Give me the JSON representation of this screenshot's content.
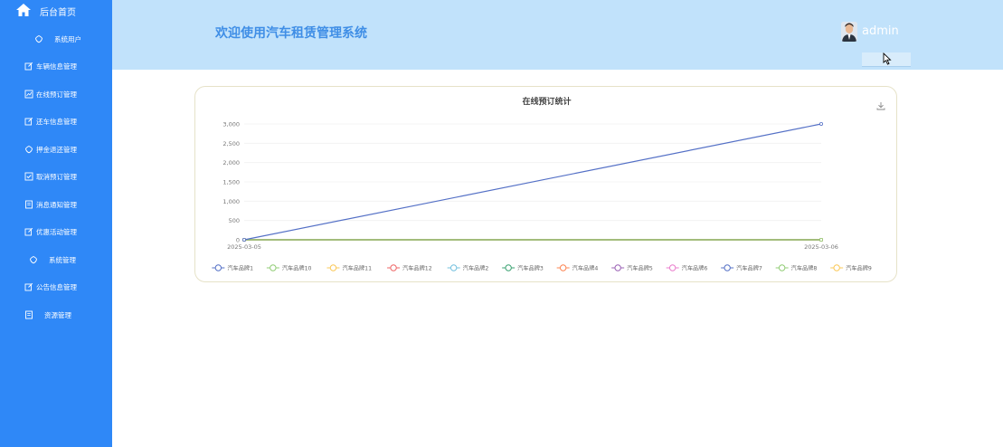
{
  "sidebar": {
    "home_label": "后台首页",
    "items": [
      {
        "label": "系统用户",
        "icon": "shield-icon"
      },
      {
        "label": "车辆信息管理",
        "icon": "edit-icon"
      },
      {
        "label": "在线预订管理",
        "icon": "chart-icon"
      },
      {
        "label": "还车信息管理",
        "icon": "edit-icon"
      },
      {
        "label": "押金退还管理",
        "icon": "shield-icon"
      },
      {
        "label": "取消预订管理",
        "icon": "check-icon"
      },
      {
        "label": "消息通知管理",
        "icon": "doc-icon"
      },
      {
        "label": "优惠活动管理",
        "icon": "edit-icon"
      },
      {
        "label": "系统管理",
        "icon": "shield-icon"
      },
      {
        "label": "公告信息管理",
        "icon": "edit-icon"
      },
      {
        "label": "资源管理",
        "icon": "doc-icon"
      }
    ]
  },
  "header": {
    "title": "欢迎使用汽车租赁管理系统",
    "username": "admin"
  },
  "colors": {
    "sidebar_bg": "#2f88f7",
    "header_bg": "#c1e2fb",
    "title_color": "#3f8ee6"
  },
  "chart_data": {
    "type": "line",
    "title": "在线预订统计",
    "x": [
      "2025-03-05",
      "2025-03-06"
    ],
    "ylim": [
      0,
      3000
    ],
    "yticks": [
      "0",
      "500",
      "1,000",
      "1,500",
      "2,000",
      "2,500",
      "3,000"
    ],
    "grid": true,
    "legend_position": "bottom",
    "series": [
      {
        "name": "汽车品牌1",
        "values": [
          0,
          3000
        ],
        "color": "#5470c6"
      },
      {
        "name": "汽车品牌10",
        "values": [
          0,
          0
        ],
        "color": "#91cc75"
      },
      {
        "name": "汽车品牌11",
        "values": [
          0,
          0
        ],
        "color": "#fac858"
      },
      {
        "name": "汽车品牌12",
        "values": [
          0,
          0
        ],
        "color": "#ee6666"
      },
      {
        "name": "汽车品牌2",
        "values": [
          0,
          0
        ],
        "color": "#73c0de"
      },
      {
        "name": "汽车品牌3",
        "values": [
          0,
          0
        ],
        "color": "#3ba272"
      },
      {
        "name": "汽车品牌4",
        "values": [
          0,
          0
        ],
        "color": "#fc8452"
      },
      {
        "name": "汽车品牌5",
        "values": [
          0,
          0
        ],
        "color": "#9a60b4"
      },
      {
        "name": "汽车品牌6",
        "values": [
          0,
          0
        ],
        "color": "#ea7ccc"
      },
      {
        "name": "汽车品牌7",
        "values": [
          0,
          0
        ],
        "color": "#5470c6"
      },
      {
        "name": "汽车品牌8",
        "values": [
          0,
          0
        ],
        "color": "#91cc75"
      },
      {
        "name": "汽车品牌9",
        "values": [
          0,
          0
        ],
        "color": "#fac858"
      }
    ]
  }
}
